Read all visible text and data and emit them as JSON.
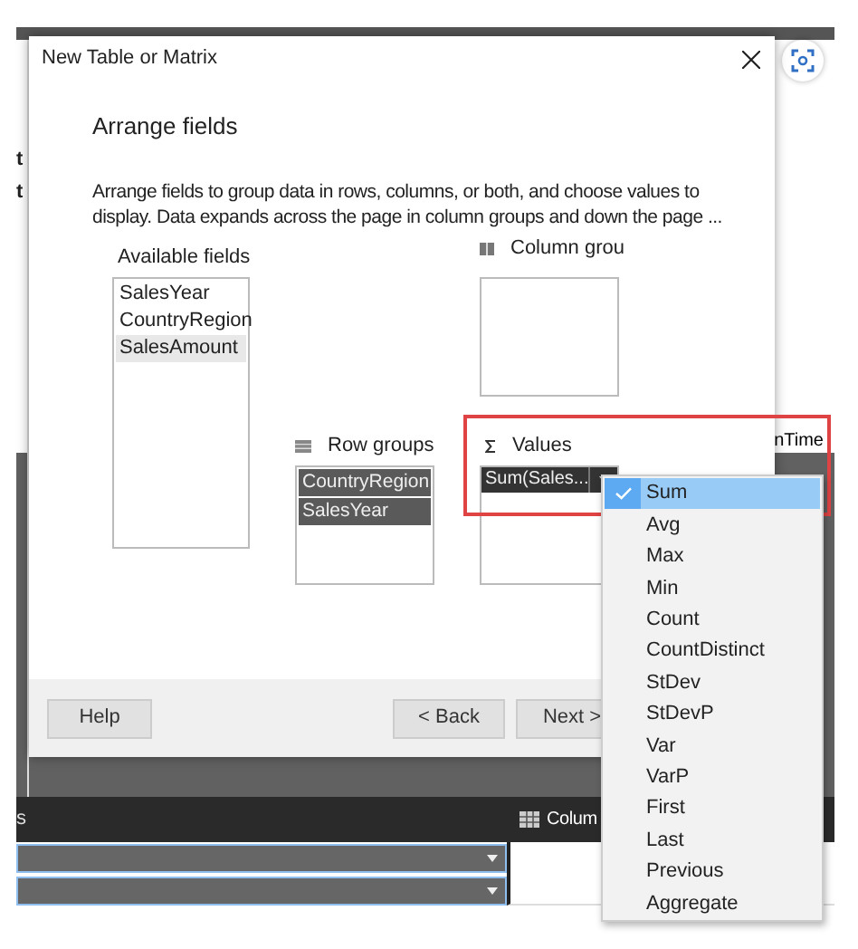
{
  "background": {
    "left_texts": [
      "t",
      "t"
    ],
    "right_text": "nTime",
    "bottom_bar": {
      "left_text": "s",
      "column_label": "Colum"
    }
  },
  "dialog": {
    "title": "New Table or Matrix",
    "heading": "Arrange fields",
    "description": "Arrange fields to group data in rows, columns, or both, and choose values to display. Data expands across the page in column groups and down the page ...",
    "available_fields": {
      "label": "Available fields",
      "items": [
        {
          "text": "SalesYear",
          "selected": false
        },
        {
          "text": "CountryRegion",
          "selected": false
        },
        {
          "text": "SalesAmount",
          "selected": true
        }
      ]
    },
    "column_groups": {
      "label": "Column grou"
    },
    "row_groups": {
      "label": "Row groups",
      "items": [
        {
          "text": "CountryRegion"
        },
        {
          "text": "SalesYear"
        }
      ]
    },
    "values": {
      "label": "Values",
      "highlighted": true,
      "items": [
        {
          "text": "Sum(Sales..."
        }
      ]
    },
    "buttons": [
      "Help",
      "< Back",
      "Next >"
    ]
  },
  "aggregate_menu": {
    "items": [
      {
        "label": "Sum",
        "checked": true,
        "selected": true
      },
      {
        "label": "Avg",
        "checked": false,
        "selected": false
      },
      {
        "label": "Max",
        "checked": false,
        "selected": false
      },
      {
        "label": "Min",
        "checked": false,
        "selected": false
      },
      {
        "label": "Count",
        "checked": false,
        "selected": false
      },
      {
        "label": "CountDistinct",
        "checked": false,
        "selected": false
      },
      {
        "label": "StDev",
        "checked": false,
        "selected": false
      },
      {
        "label": "StDevP",
        "checked": false,
        "selected": false
      },
      {
        "label": "Var",
        "checked": false,
        "selected": false
      },
      {
        "label": "VarP",
        "checked": false,
        "selected": false
      },
      {
        "label": "First",
        "checked": false,
        "selected": false
      },
      {
        "label": "Last",
        "checked": false,
        "selected": false
      },
      {
        "label": "Previous",
        "checked": false,
        "selected": false
      },
      {
        "label": "Aggregate",
        "checked": false,
        "selected": false
      }
    ]
  }
}
